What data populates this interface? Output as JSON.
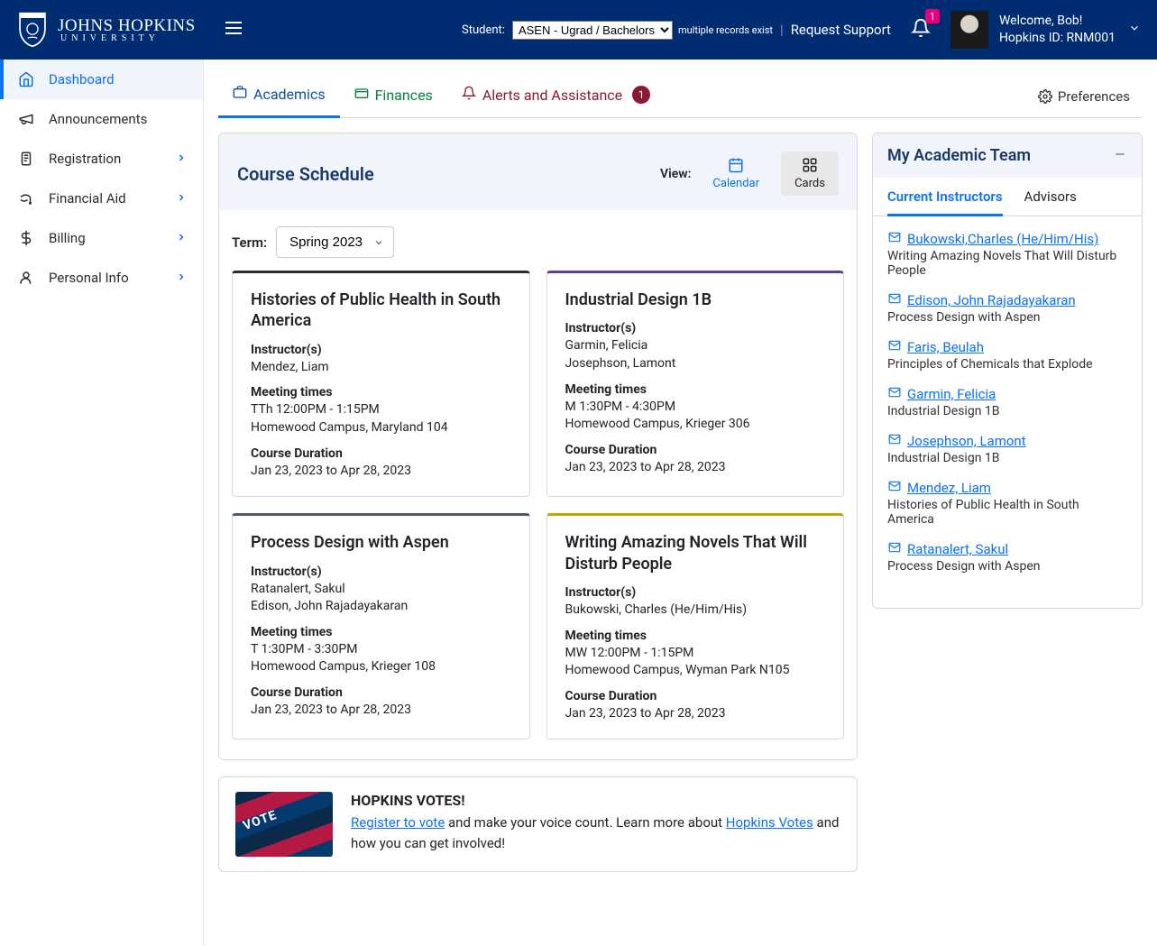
{
  "header": {
    "university_main": "JOHNS HOPKINS",
    "university_sub": "UNIVERSITY",
    "student_label": "Student:",
    "student_select_value": "ASEN - Ugrad / Bachelors",
    "multiple_records": "multiple records exist",
    "request_support": "Request Support",
    "notification_count": "1",
    "welcome_line": "Welcome, Bob!",
    "hopkins_id_line": "Hopkins ID: RNM001"
  },
  "sidebar": {
    "items": [
      {
        "label": "Dashboard",
        "active": true,
        "chevron": false
      },
      {
        "label": "Announcements",
        "active": false,
        "chevron": false
      },
      {
        "label": "Registration",
        "active": false,
        "chevron": true
      },
      {
        "label": "Financial Aid",
        "active": false,
        "chevron": true
      },
      {
        "label": "Billing",
        "active": false,
        "chevron": true
      },
      {
        "label": "Personal Info",
        "active": false,
        "chevron": true
      }
    ]
  },
  "tabs": {
    "academics": "Academics",
    "finances": "Finances",
    "alerts": "Alerts and Assistance",
    "alerts_badge": "1",
    "preferences": "Preferences"
  },
  "schedule": {
    "title": "Course Schedule",
    "view_label": "View:",
    "calendar_label": "Calendar",
    "cards_label": "Cards",
    "term_label": "Term:",
    "term_value": "Spring 2023",
    "labels": {
      "instructors": "Instructor(s)",
      "meeting": "Meeting times",
      "duration": "Course Duration"
    },
    "courses": [
      {
        "title": "Histories of Public Health in South America",
        "color": "#2c2c2c",
        "instructors": "Mendez, Liam",
        "meeting1": "TTh 12:00PM - 1:15PM",
        "meeting2": "Homewood Campus, Maryland 104",
        "duration": "Jan 23, 2023 to Apr 28, 2023"
      },
      {
        "title": "Industrial Design 1B",
        "color": "#5b3f91",
        "instructors": "Garmin, Felicia\nJosephson, Lamont",
        "meeting1": "M 1:30PM - 4:30PM",
        "meeting2": "Homewood Campus, Krieger 306",
        "duration": "Jan 23, 2023 to Apr 28, 2023"
      },
      {
        "title": "Process Design with Aspen",
        "color": "#4a5a6a",
        "instructors": "Ratanalert, Sakul\nEdison, John Rajadayakaran",
        "meeting1": "T 1:30PM - 3:30PM",
        "meeting2": "Homewood Campus, Krieger 108",
        "duration": "Jan 23, 2023 to Apr 28, 2023"
      },
      {
        "title": "Writing Amazing Novels That Will Disturb People",
        "color": "#c6a400",
        "instructors": "Bukowski, Charles (He/Him/His)",
        "meeting1": "MW 12:00PM - 1:15PM",
        "meeting2": "Homewood Campus, Wyman Park N105",
        "duration": "Jan 23, 2023 to Apr 28, 2023"
      }
    ]
  },
  "votes": {
    "title": "HOPKINS VOTES!",
    "register_link": "Register to vote",
    "mid_text": " and make your voice count. Learn more about ",
    "hopkins_link": "Hopkins Votes",
    "tail_text": " and how you can get involved!"
  },
  "team": {
    "title": "My Academic Team",
    "tab_current": "Current Instructors",
    "tab_advisors": "Advisors",
    "instructors": [
      {
        "name": "Bukowski,Charles (He/Him/His)",
        "course": "Writing Amazing Novels That Will Disturb People"
      },
      {
        "name": "Edison, John Rajadayakaran",
        "course": "Process Design with Aspen"
      },
      {
        "name": "Faris, Beulah",
        "course": "Principles of Chemicals that Explode"
      },
      {
        "name": "Garmin, Felicia",
        "course": "Industrial Design 1B"
      },
      {
        "name": "Josephson, Lamont",
        "course": "Industrial Design 1B"
      },
      {
        "name": "Mendez, Liam",
        "course": "Histories of Public Health in South America"
      },
      {
        "name": "Ratanalert, Sakul",
        "course": "Process Design with Aspen"
      }
    ]
  }
}
